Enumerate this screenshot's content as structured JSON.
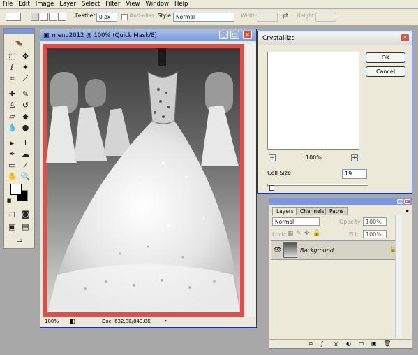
{
  "menu": [
    "File",
    "Edit",
    "Image",
    "Layer",
    "Select",
    "Filter",
    "View",
    "Window",
    "Help"
  ],
  "options": {
    "feather_label": "Feather:",
    "feather_value": "0 px",
    "antialias_label": "Anti-alias",
    "style_label": "Style:",
    "style_value": "Normal",
    "width_label": "Width:",
    "height_label": "Height:"
  },
  "document": {
    "title": "menu2012 @ 100% (Quick Mask/8)",
    "zoom": "100%",
    "doc_info": "Doc: 632.8K/843.8K"
  },
  "dialog": {
    "title": "Crystallize",
    "ok": "OK",
    "cancel": "Cancel",
    "preview_zoom": "100%",
    "cell_size_label": "Cell Size",
    "cell_size_value": "19"
  },
  "layers_panel": {
    "tabs": [
      "Layers",
      "Channels",
      "Paths"
    ],
    "blend_mode": "Normal",
    "opacity_label": "Opacity:",
    "opacity_value": "100%",
    "lock_label": "Lock:",
    "fill_label": "Fill:",
    "fill_value": "100%",
    "layer_name": "Background"
  },
  "colors": {
    "quick_mask_red": "#e14c4c",
    "title_blue": "#7a96df",
    "chrome": "#ece9d8"
  }
}
